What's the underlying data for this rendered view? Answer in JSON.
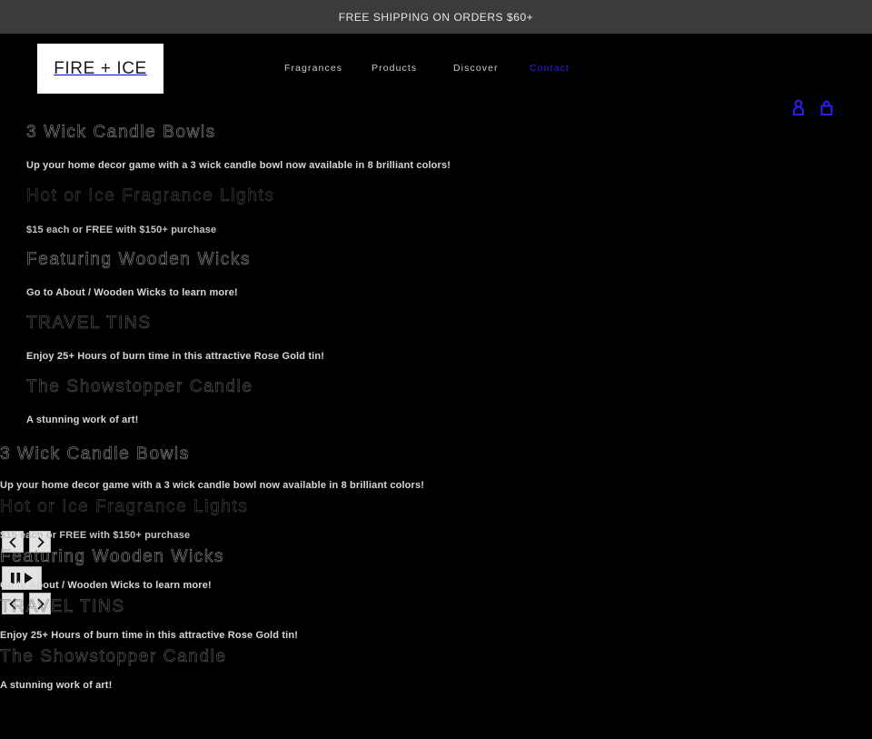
{
  "announcement": {
    "text": "FREE SHIPPING ON ORDERS $60+"
  },
  "header": {
    "logo_text": "FIRE + ICE",
    "nav": [
      {
        "label": "Fragrances",
        "active": false
      },
      {
        "label": "Products",
        "active": false
      },
      {
        "label": "Discover",
        "active": false
      },
      {
        "label": "Contact",
        "active": true
      }
    ],
    "icons": [
      {
        "name": "account-icon",
        "label": "Account"
      },
      {
        "name": "cart-icon",
        "label": "Cart"
      }
    ],
    "accent_color": "#2b1ef2"
  },
  "slides": [
    {
      "heading": "3 Wick Candle Bowls",
      "body": "Up your home decor game with a 3 wick candle bowl now available in 8 brilliant colors!"
    },
    {
      "heading": "Hot or Ice Fragrance Lights",
      "body": "$15 each or FREE with $150+ purchase"
    },
    {
      "heading": "Featuring Wooden Wicks",
      "body": "Go to About / Wooden Wicks to learn more!"
    },
    {
      "heading": "TRAVEL TINS",
      "body": "Enjoy 25+ Hours of burn time in this attractive Rose Gold tin!"
    },
    {
      "heading": "The Showstopper Candle",
      "body": "A stunning work of art!"
    }
  ],
  "carousel_controls": {
    "previous_label": "Previous slide",
    "next_label": "Next slide",
    "pause_label": "Pause",
    "play_label": "Play"
  },
  "theme": {
    "background": "#000000",
    "announcement_background": "#3b3b3b",
    "text_color": "#d6d6d6",
    "link_active": "#2b1ef2"
  }
}
